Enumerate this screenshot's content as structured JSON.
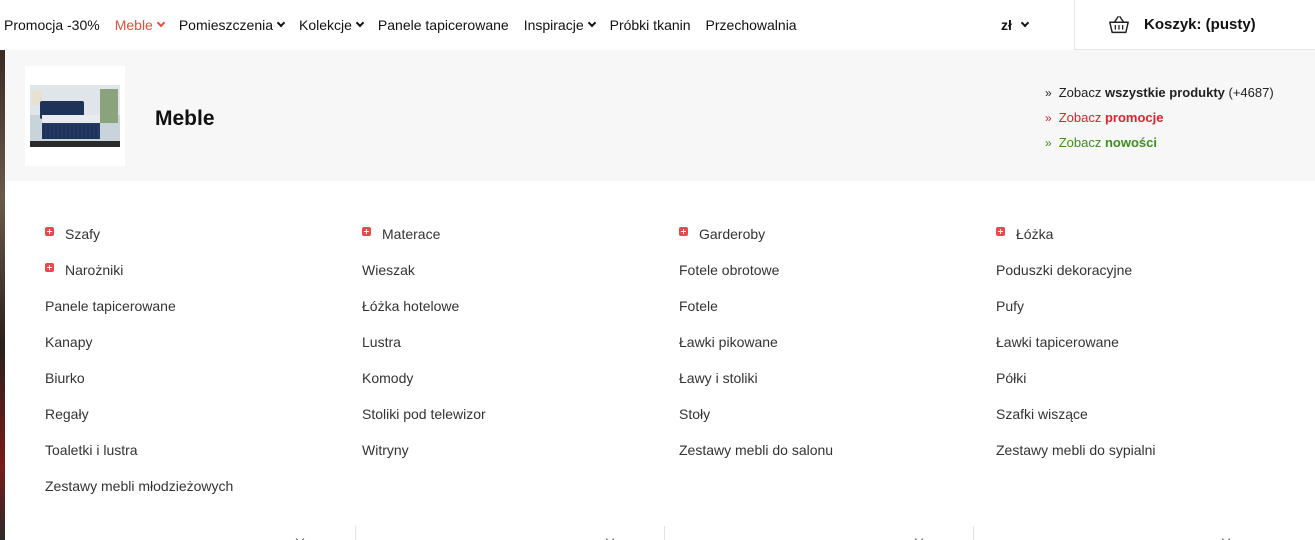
{
  "nav": {
    "items": [
      {
        "label": "Promocja -30%",
        "dropdown": false,
        "active": false
      },
      {
        "label": "Meble",
        "dropdown": true,
        "active": true
      },
      {
        "label": "Pomieszczenia",
        "dropdown": true,
        "active": false
      },
      {
        "label": "Kolekcje",
        "dropdown": true,
        "active": false
      },
      {
        "label": "Panele tapicerowane",
        "dropdown": false,
        "active": false
      },
      {
        "label": "Inspiracje",
        "dropdown": true,
        "active": false
      },
      {
        "label": "Próbki tkanin",
        "dropdown": false,
        "active": false
      },
      {
        "label": "Przechowalnia",
        "dropdown": false,
        "active": false
      }
    ],
    "currency": "zł",
    "cart_label": "Koszyk: (pusty)",
    "cart_icon": "basket-icon",
    "active_color": "#e0503a"
  },
  "panel": {
    "title": "Meble",
    "thumbnail": "bed-thumbnail",
    "links": [
      {
        "prefix": "Zobacz",
        "bold": "wszystkie produkty",
        "suffix": "(+4687)",
        "color": "#222222"
      },
      {
        "prefix": "Zobacz",
        "bold": "promocje",
        "suffix": "",
        "color": "#d7262c"
      },
      {
        "prefix": "Zobacz",
        "bold": "nowości",
        "suffix": "",
        "color": "#3e8f1e"
      }
    ]
  },
  "categories": [
    [
      {
        "label": "Szafy",
        "expandable": true
      },
      {
        "label": "Narożniki",
        "expandable": true
      },
      {
        "label": "Panele tapicerowane",
        "expandable": false
      },
      {
        "label": "Kanapy",
        "expandable": false
      },
      {
        "label": "Biurko",
        "expandable": false
      },
      {
        "label": "Regały",
        "expandable": false
      },
      {
        "label": "Toaletki i lustra",
        "expandable": false
      },
      {
        "label": "Zestawy mebli młodzieżowych",
        "expandable": false
      }
    ],
    [
      {
        "label": "Materace",
        "expandable": true
      },
      {
        "label": "Wieszak",
        "expandable": false
      },
      {
        "label": "Łóżka hotelowe",
        "expandable": false
      },
      {
        "label": "Lustra",
        "expandable": false
      },
      {
        "label": "Komody",
        "expandable": false
      },
      {
        "label": "Stoliki pod telewizor",
        "expandable": false
      },
      {
        "label": "Witryny",
        "expandable": false
      }
    ],
    [
      {
        "label": "Garderoby",
        "expandable": true
      },
      {
        "label": "Fotele obrotowe",
        "expandable": false
      },
      {
        "label": "Fotele",
        "expandable": false
      },
      {
        "label": "Ławki pikowane",
        "expandable": false
      },
      {
        "label": "Ławy i stoliki",
        "expandable": false
      },
      {
        "label": "Stoły",
        "expandable": false
      },
      {
        "label": "Zestawy mebli do salonu",
        "expandable": false
      }
    ],
    [
      {
        "label": "Łóżka",
        "expandable": true
      },
      {
        "label": "Poduszki dekoracyjne",
        "expandable": false
      },
      {
        "label": "Pufy",
        "expandable": false
      },
      {
        "label": "Ławki tapicerowane",
        "expandable": false
      },
      {
        "label": "Półki",
        "expandable": false
      },
      {
        "label": "Szafki wiszące",
        "expandable": false
      },
      {
        "label": "Zestawy mebli do sypialni",
        "expandable": false
      }
    ]
  ],
  "plus_icon_color": "#e44b4b"
}
